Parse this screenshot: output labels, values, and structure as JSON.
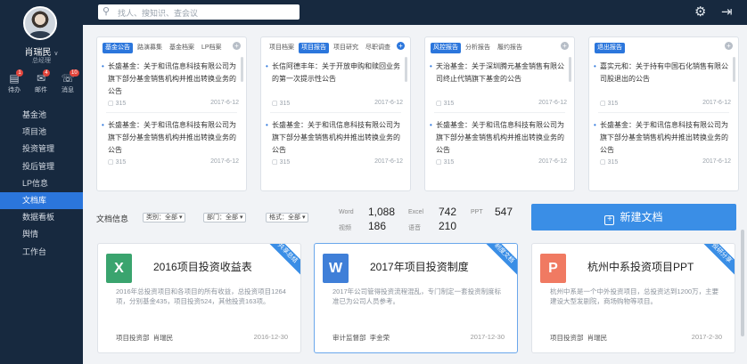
{
  "user": {
    "name": "肖瑞民",
    "role": "总经理"
  },
  "quick_icons": [
    {
      "label": "待办",
      "badge": "1",
      "icon": "task-icon"
    },
    {
      "label": "邮件",
      "badge": "4",
      "icon": "mail-icon"
    },
    {
      "label": "消息",
      "badge": "10",
      "icon": "message-icon"
    }
  ],
  "nav": [
    "基金池",
    "项目池",
    "投资管理",
    "投后管理",
    "LP信息",
    "文档库",
    "数据看板",
    "舆情",
    "工作台"
  ],
  "nav_active": "文档库",
  "search": {
    "placeholder": "找人、搜知识、查会议"
  },
  "panels": [
    {
      "tabs": [
        "基金公告",
        "路演募集",
        "基金档案",
        "LP档案"
      ],
      "entries": [
        {
          "text": "长盛基金：关于和讯信息科技有限公司为旗下部分基金销售机构并推出转换业务的公告",
          "count": "315",
          "date": "2017-6-12"
        },
        {
          "text": "长盛基金：关于和讯信息科技有限公司为旗下部分基金销售机构并推出转换业务的公告",
          "count": "315",
          "date": "2017-6-12"
        }
      ]
    },
    {
      "tabs": [
        "项目档案",
        "项目报告",
        "项目研究",
        "尽职调查"
      ],
      "entries": [
        {
          "text": "长信阿德丰年：关于开放申购和赎回业务的第一次提示性公告",
          "count": "315",
          "date": "2017-6-12"
        },
        {
          "text": "长盛基金：关于和讯信息科技有限公司为旗下部分基金销售机构并推出转换业务的公告",
          "count": "315",
          "date": "2017-6-12"
        }
      ]
    },
    {
      "tabs": [
        "风控报告",
        "分析报告",
        "履约报告"
      ],
      "entries": [
        {
          "text": "天治基金：关于深圳腾元基金销售有限公司终止代销旗下基金的公告",
          "count": "315",
          "date": "2017-6-12"
        },
        {
          "text": "长盛基金：关于和讯信息科技有限公司为旗下部分基金销售机构并推出转换业务的公告",
          "count": "315",
          "date": "2017-6-12"
        }
      ]
    },
    {
      "tabs": [
        "退出报告"
      ],
      "entries": [
        {
          "text": "嘉实元和：关于持有中国石化销售有限公司股退出的公告",
          "count": "315",
          "date": "2017-6-12"
        },
        {
          "text": "长盛基金：关于和讯信息科技有限公司为旗下部分基金销售机构并推出转换业务的公告",
          "count": "315",
          "date": "2017-6-12"
        }
      ]
    }
  ],
  "filters": {
    "label": "文档信息",
    "category": "类别：全部",
    "department": "部门：全部",
    "format": "格式：全部"
  },
  "stats": [
    {
      "label": "Word",
      "value": "1,088"
    },
    {
      "label": "Excel",
      "value": "742"
    },
    {
      "label": "PPT",
      "value": "547"
    },
    {
      "label": "视频",
      "value": "186"
    },
    {
      "label": "语音",
      "value": "210"
    }
  ],
  "new_doc_label": "新建文档",
  "docs": [
    {
      "type": "X",
      "color": "#3aa46e",
      "ribbon": "共享总结",
      "ribbon_color": "#3a8ee6",
      "title": "2016项目投资收益表",
      "desc": "2016年总投资项目和各项目的所有收益，总投资项目1264项，分别基金435，项目投资524，其他投资163项。",
      "dept": "项目投资部",
      "owner": "肖瑞民",
      "date": "2016-12-30"
    },
    {
      "type": "W",
      "color": "#3f7fd8",
      "ribbon": "制度文档",
      "ribbon_color": "#3a8ee6",
      "title": "2017年项目投资制度",
      "desc": "2017年公司管得投资流程混乱，专门制定一套投资制度标准已为公司人员参考。",
      "dept": "审计监督部",
      "owner": "李金荣",
      "date": "2017-12-30"
    },
    {
      "type": "P",
      "color": "#f07a62",
      "ribbon": "投研分享",
      "ribbon_color": "#3a8ee6",
      "title": "杭州中系投资项目PPT",
      "desc": "杭州中系是一个中外投资项目，总投资达到1200万，主要建设大型发剧院，商场购物等项目。",
      "dept": "项目投资部",
      "owner": "肖瑞民",
      "date": "2017-2-30"
    }
  ],
  "colors": {
    "sidebar": "#17293f",
    "accent": "#2b76dc"
  }
}
